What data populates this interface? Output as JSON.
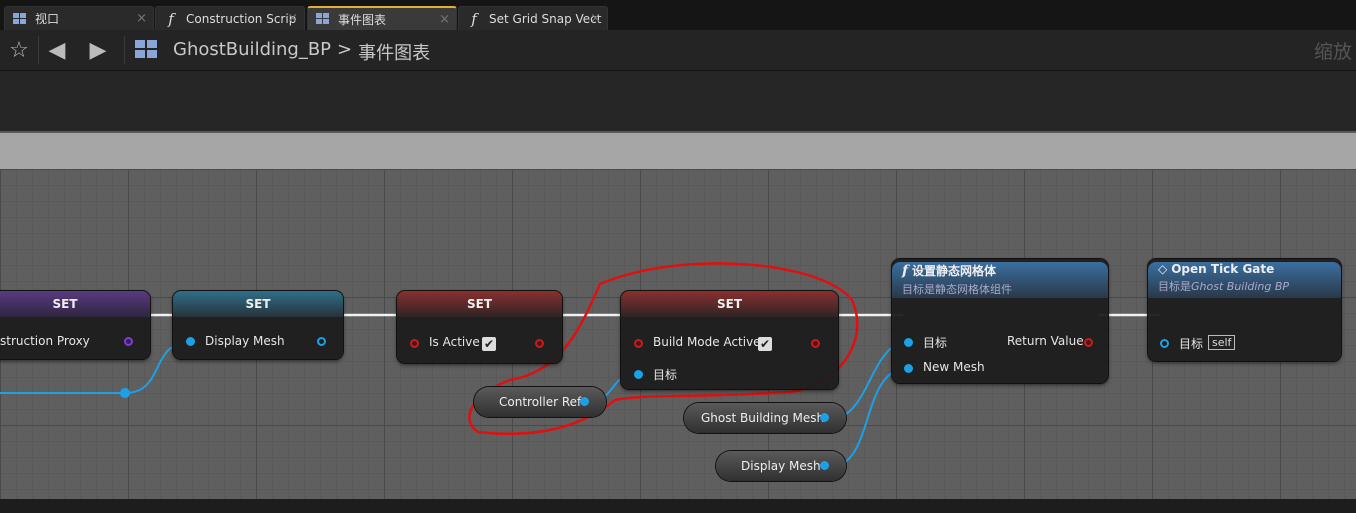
{
  "tabs": [
    {
      "label": "视口",
      "icon": "viewport-icon",
      "active": false
    },
    {
      "label": "Construction Scrip",
      "icon": "function-icon",
      "active": false
    },
    {
      "label": "事件图表",
      "icon": "event-graph-icon",
      "active": true
    },
    {
      "label": "Set Grid Snap Vect",
      "icon": "function-icon",
      "active": false
    }
  ],
  "breadcrumb": {
    "root": "GhostBuilding_BP",
    "separator": ">",
    "current": "事件图表"
  },
  "zoom_label": "缩放",
  "nodes": {
    "set1": {
      "title": "SET",
      "input_label": "struction Proxy"
    },
    "set2": {
      "title": "SET",
      "input_label": "Display Mesh"
    },
    "set3": {
      "title": "SET",
      "input_label": "Is Active"
    },
    "set4": {
      "title": "SET",
      "input_label": "Build Mode Active",
      "target_label": "目标"
    },
    "setmesh": {
      "title": "设置静态网格体",
      "subtitle": "目标是静态网格体组件",
      "target_label": "目标",
      "newmesh_label": "New Mesh",
      "return_label": "Return Value"
    },
    "gate": {
      "title": "Open Tick Gate",
      "subtitle_prefix": "目标是",
      "subtitle_class": "Ghost Building BP",
      "target_label": "目标",
      "self_label": "self"
    }
  },
  "vars": {
    "controller_ref": "Controller Ref",
    "ghost_mesh": "Ghost Building Mesh",
    "display_mesh": "Display Mesh"
  },
  "colors": {
    "accent_tab": "#e0b030",
    "object_pin": "#1ca0e6",
    "bool_pin": "#c02020",
    "annotation": "#e01010"
  }
}
